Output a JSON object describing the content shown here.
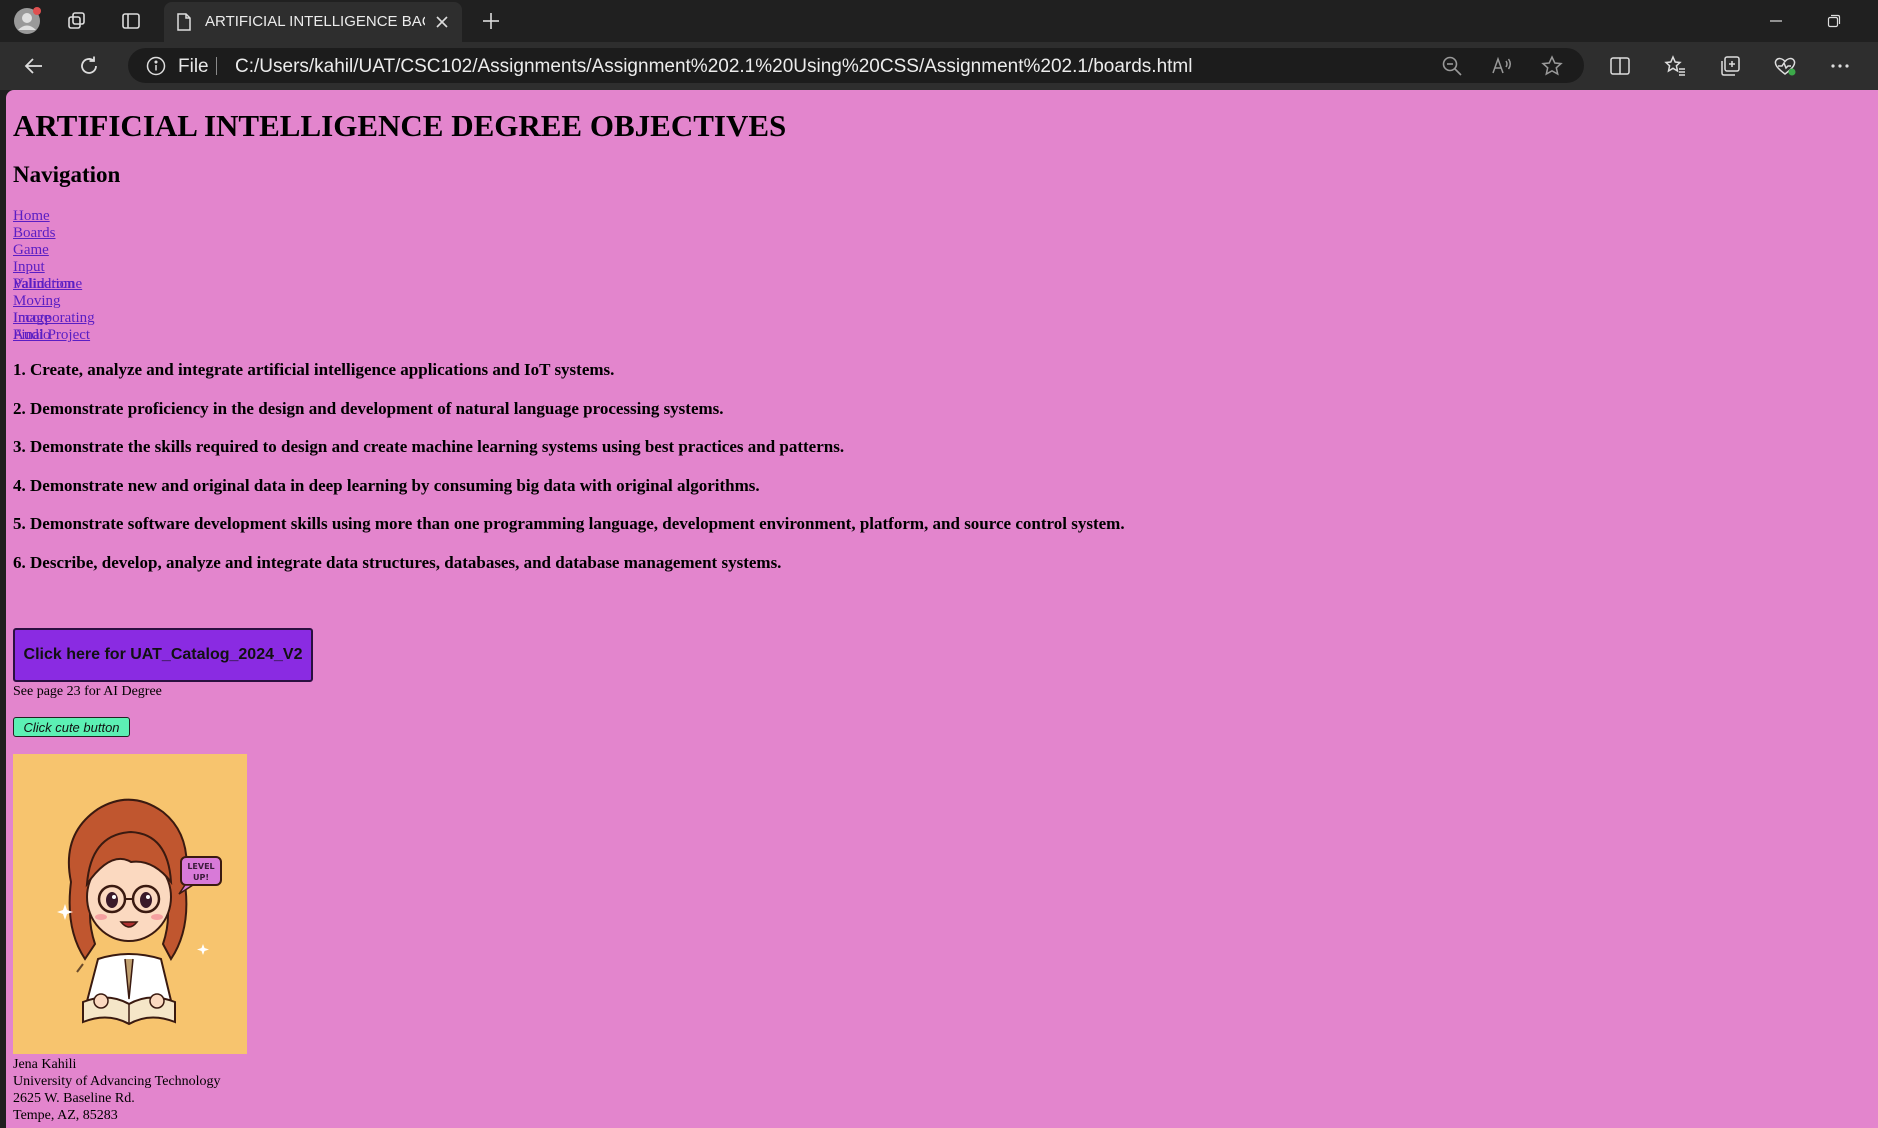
{
  "browser": {
    "tab_title": "ARTIFICIAL INTELLIGENCE BACHELOR",
    "file_label": "File",
    "url": "C:/Users/kahil/UAT/CSC102/Assignments/Assignment%202.1%20Using%20CSS/Assignment%202.1/boards.html",
    "icons": [
      "profile-icon",
      "workspaces-icon",
      "vertical-tabs-icon",
      "page-icon",
      "close-icon",
      "new-tab-icon",
      "minimize-icon",
      "restore-icon",
      "back-icon",
      "refresh-icon",
      "info-icon",
      "zoom-out-icon",
      "read-aloud-icon",
      "favorite-star-icon",
      "split-screen-icon",
      "favorites-icon",
      "collections-icon",
      "browser-essentials-icon",
      "more-icon"
    ]
  },
  "page": {
    "title": "ARTIFICIAL INTELLIGENCE DEGREE OBJECTIVES",
    "nav_heading": "Navigation",
    "nav_links": [
      "Home",
      "Boards",
      "Game",
      "Input Validation",
      "Palindrome",
      "Moving Image",
      "Incorporating Audio",
      "Final Project"
    ],
    "objectives": [
      "1. Create, analyze and integrate artificial intelligence applications and IoT systems.",
      "2. Demonstrate proficiency in the design and development of natural language processing systems.",
      "3. Demonstrate the skills required to design and create machine learning systems using best practices and patterns.",
      "4. Demonstrate new and original data in deep learning by consuming big data with original algorithms.",
      "5. Demonstrate software development skills using more than one programming language, development environment, platform, and source control system.",
      "6. Describe, develop, analyze and integrate data structures, databases, and database management systems."
    ],
    "catalog_button": "Click here for UAT_Catalog_2024_V2",
    "see_page": "See page 23 for AI Degree",
    "cute_button": "Click cute button",
    "image_caption_text": "LEVEL UP!",
    "address": [
      "Jena Kahili",
      "University of Advancing Technology",
      "2625 W. Baseline Rd.",
      "Tempe, AZ, 85283"
    ],
    "colors": {
      "background": "#e385cd",
      "catalog_button": "#8a2be2",
      "cute_button": "#5cf0b4",
      "link": "#5a1ec4",
      "image_bg": "#f7c46e"
    }
  }
}
